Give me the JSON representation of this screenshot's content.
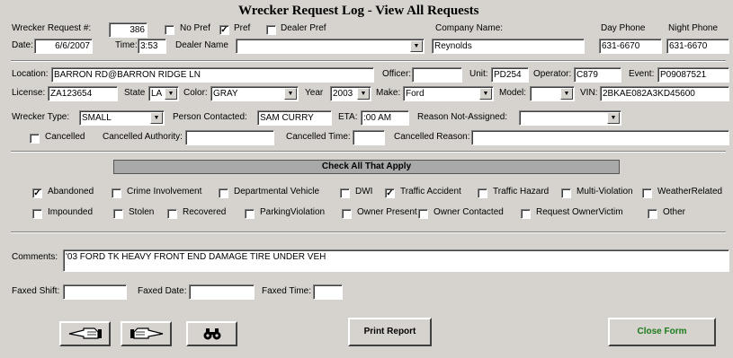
{
  "form": {
    "title": "Wrecker Request Log - View All Requests"
  },
  "request": {
    "number_label": "Wrecker Request #:",
    "number": "386",
    "no_pref_label": "No Pref",
    "no_pref": false,
    "pref_label": "Pref",
    "pref": true,
    "dealer_pref_label": "Dealer Pref",
    "dealer_pref": false,
    "date_label": "Date:",
    "date": "6/6/2007",
    "time_label": "Time:",
    "time": "3:53",
    "dealer_name_label": "Dealer Name",
    "dealer_name": ""
  },
  "company": {
    "name_label": "Company Name:",
    "name": "Reynolds",
    "day_phone_label": "Day Phone",
    "day_phone": "631-6670",
    "night_phone_label": "Night Phone",
    "night_phone": "631-6670"
  },
  "incident": {
    "location_label": "Location:",
    "location": "BARRON RD@BARRON RIDGE LN",
    "officer_label": "Officer:",
    "officer": "",
    "unit_label": "Unit:",
    "unit": "PD254",
    "operator_label": "Operator:",
    "operator": "C879",
    "event_label": "Event:",
    "event": "P09087521"
  },
  "vehicle": {
    "license_label": "License:",
    "license": "ZA123654",
    "state_label": "State",
    "state": "LA",
    "color_label": "Color:",
    "color": "GRAY",
    "year_label": "Year",
    "year": "2003",
    "make_label": "Make:",
    "make": "Ford",
    "model_label": "Model:",
    "model": "",
    "vin_label": "VIN:",
    "vin": "2BKAE082A3KD45600"
  },
  "wrecker": {
    "type_label": "Wrecker Type:",
    "type": "SMALL",
    "person_label": "Person Contacted:",
    "person": "SAM CURRY",
    "eta_label": "ETA:",
    "eta": ":00 AM",
    "reason_label": "Reason Not-Assigned:",
    "reason": ""
  },
  "cancel": {
    "cancelled_label": "Cancelled",
    "cancelled": false,
    "authority_label": "Cancelled Authority:",
    "authority": "",
    "time_label": "Cancelled Time:",
    "time": "",
    "reason_label": "Cancelled Reason:",
    "reason": ""
  },
  "checklist": {
    "banner": "Check All That Apply",
    "row1": [
      {
        "label": "Abandoned",
        "checked": true
      },
      {
        "label": "Crime Involvement",
        "checked": false
      },
      {
        "label": "Departmental Vehicle",
        "checked": false
      },
      {
        "label": "DWI",
        "checked": false
      },
      {
        "label": "Traffic Accident",
        "checked": true
      },
      {
        "label": "Traffic Hazard",
        "checked": false
      },
      {
        "label": "Multi-Violation",
        "checked": false
      },
      {
        "label": "WeatherRelated",
        "checked": false
      }
    ],
    "row2": [
      {
        "label": "Impounded",
        "checked": false
      },
      {
        "label": "Stolen",
        "checked": false
      },
      {
        "label": "Recovered",
        "checked": false
      },
      {
        "label": "ParkingViolation",
        "checked": false
      },
      {
        "label": "Owner Present",
        "checked": false
      },
      {
        "label": "Owner Contacted",
        "checked": false
      },
      {
        "label": "Request OwnerVictim",
        "checked": false
      },
      {
        "label": "Other",
        "checked": false
      }
    ]
  },
  "comments": {
    "label": "Comments:",
    "text": "'03 FORD TK HEAVY FRONT END DAMAGE TIRE UNDER VEH"
  },
  "fax": {
    "shift_label": "Faxed Shift:",
    "shift": "",
    "date_label": "Faxed Date:",
    "date": "",
    "time_label": "Faxed Time:",
    "time": ""
  },
  "buttons": {
    "prev_icon": "pointing-hand-left-icon",
    "next_icon": "pointing-hand-right-icon",
    "find_icon": "binoculars-icon",
    "print_label": "Print Report",
    "close_label": "Close Form"
  },
  "colors": {
    "close_text": "#1a7a1a",
    "form_bg": "#d6d3ce",
    "banner_bg": "#a9a9a9"
  }
}
